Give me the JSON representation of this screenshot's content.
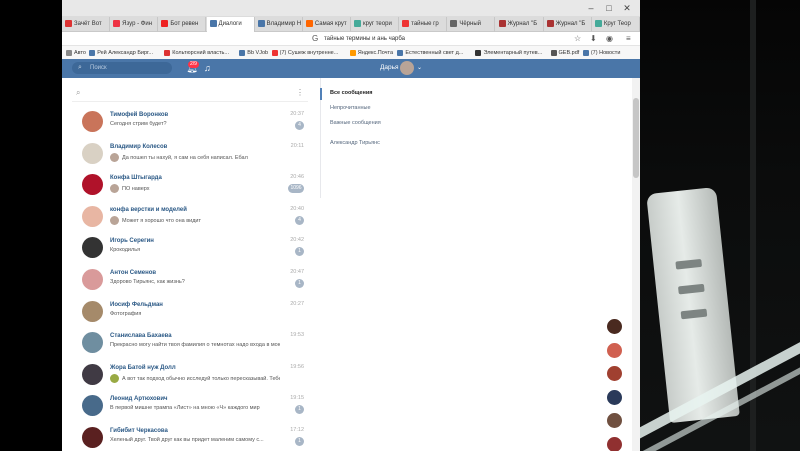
{
  "window": {
    "min": "–",
    "max": "□",
    "close": "✕"
  },
  "tabs": [
    {
      "label": "Зачёт Вот",
      "color": "#d33"
    },
    {
      "label": "Язур - Фин",
      "color": "#e34"
    },
    {
      "label": "Бот ревен",
      "color": "#e22"
    },
    {
      "label": "Диалоги",
      "color": "#4a76a8",
      "active": true
    },
    {
      "label": "Владимир Н",
      "color": "#4a76a8"
    },
    {
      "label": "Самая крут",
      "color": "#f60"
    },
    {
      "label": "круг теори",
      "color": "#4a9"
    },
    {
      "label": "тайные гр",
      "color": "#e33"
    },
    {
      "label": "Чёрный",
      "color": "#666"
    },
    {
      "label": "Журнал \"Б",
      "color": "#a33"
    },
    {
      "label": "Журнал \"Б",
      "color": "#a33"
    },
    {
      "label": "Круг Теор",
      "color": "#4a9"
    }
  ],
  "address": {
    "url": "тайные термины и ань чарба"
  },
  "bookmarks": [
    {
      "label": "Авто",
      "color": "#888"
    },
    {
      "label": "Рей Александр Бирг...",
      "color": "#4a76a8"
    },
    {
      "label": "Кольтюрсний власть...",
      "color": "#d33"
    },
    {
      "label": "Bb VJob",
      "color": "#4a76a8"
    },
    {
      "label": "(7) Сушеж внутренне...",
      "color": "#e33"
    },
    {
      "label": "Яндекс.Почта",
      "color": "#f90"
    },
    {
      "label": "Естественный свет д...",
      "color": "#4a76a8"
    },
    {
      "label": "Элементарный путев...",
      "color": "#333"
    },
    {
      "label": "GEB.pdf",
      "color": "#555"
    },
    {
      "label": "(7) Новости",
      "color": "#4a76a8"
    }
  ],
  "header": {
    "search_placeholder": "Поиск",
    "notif_count": "2/9",
    "user_name": "Дарья"
  },
  "dialogs": [
    {
      "name": "Тимофей Воронков",
      "msg": "Сегодня стрим будет?",
      "time": "20:37",
      "badge": "4",
      "ava": "#c9745a"
    },
    {
      "name": "Владимир Колесов",
      "msg": "Да пошел ты нахуй, я сам на себя написал. Ебал",
      "time": "20:11",
      "badge": "",
      "ava": "#d9d1c4",
      "mini": "#b9a497"
    },
    {
      "name": "Конфа Штыгарда",
      "msg": "ПО наверх",
      "time": "20:46",
      "badge": "1096",
      "ava": "#b0122a",
      "mini": "#b9a497"
    },
    {
      "name": "конфа верстки и моделей",
      "msg": "Может я хорошо что она видит",
      "time": "20:40",
      "badge": "4",
      "ava": "#e8b6a3",
      "mini": "#b9a497"
    },
    {
      "name": "Игорь Серегин",
      "msg": "Крокодилья",
      "time": "20:42",
      "badge": "1",
      "ava": "#333333"
    },
    {
      "name": "Антон Семенов",
      "msg": "Здорово Тирьянс, как жизнь?",
      "time": "20:47",
      "badge": "1",
      "ava": "#d99a9a"
    },
    {
      "name": "Иосиф Фельдман",
      "msg": "Фотография",
      "time": "20:27",
      "badge": "",
      "ava": "#a58a6a"
    },
    {
      "name": "Станислава Бахаева",
      "msg": "Прекрасно могу найти твоя фамилия о темнотах надо входа в мою сторону",
      "time": "19:53",
      "badge": "",
      "ava": "#6f8ea0"
    },
    {
      "name": "Жора Батой нуж Долл",
      "msg": "А вот так подход обычно исследуй только пересказывай. Тебе",
      "time": "19:56",
      "badge": "",
      "ava": "#403a44",
      "mini": "#9a4"
    },
    {
      "name": "Леонид Артюхович",
      "msg": "В первой мишне трампа «Лист» на мною «Ч» каждого мир",
      "time": "19:15",
      "badge": "1",
      "ava": "#486a8a"
    },
    {
      "name": "Гибибит Черкасова",
      "msg": "Хеленый друг. Твой друг как вы придет маленим самому с...",
      "time": "17:12",
      "badge": "1",
      "ava": "#5a2020"
    }
  ],
  "folders": [
    {
      "label": "Все сообщения",
      "selected": true
    },
    {
      "label": "Непрочитанные"
    },
    {
      "label": "Важные сообщения"
    },
    {
      "label": "Александр Тирьянс"
    }
  ],
  "float_avatars": [
    "#4a2a20",
    "#d06050",
    "#a04030",
    "#2a3a5a",
    "#705040",
    "#903030"
  ]
}
